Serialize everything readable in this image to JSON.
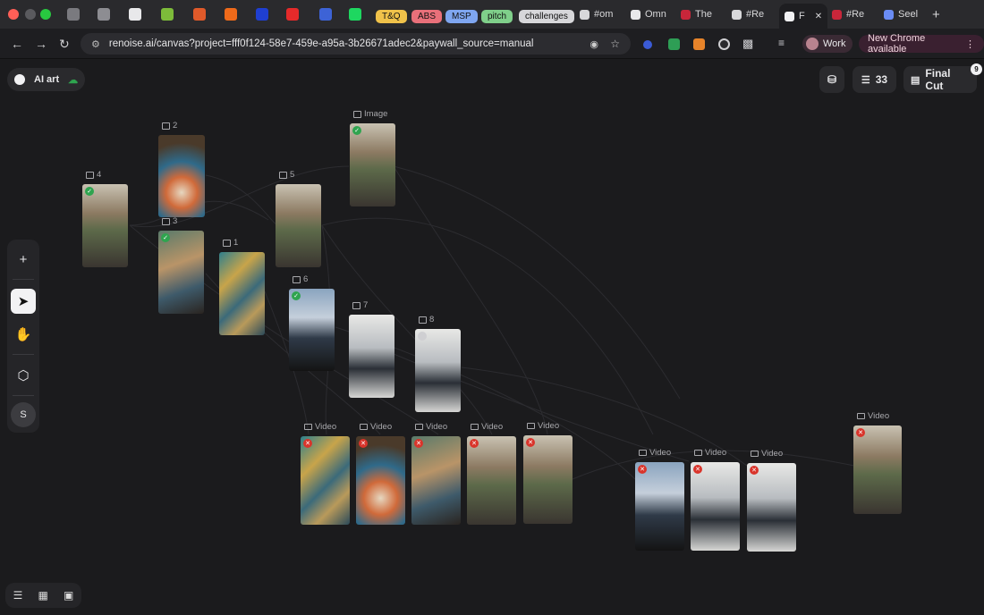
{
  "browser": {
    "tabs": [
      {
        "label": "",
        "color": "#7a7a7f"
      },
      {
        "label": "",
        "color": "#8d8d92"
      },
      {
        "label": "",
        "color": "#e8e8ea"
      },
      {
        "label": "",
        "color": "#7dbb3a"
      },
      {
        "label": "",
        "color": "#e05a2a"
      },
      {
        "label": "",
        "color": "#ef6a1a"
      },
      {
        "label": "",
        "color": "#1f3fd1"
      },
      {
        "label": "",
        "color": "#e52a2a"
      },
      {
        "label": "",
        "color": "#3d63d6"
      },
      {
        "label": "",
        "color": "#1ed760"
      }
    ],
    "pills": [
      {
        "label": "T&Q",
        "color": "#f0c24a"
      },
      {
        "label": "ABS",
        "color": "#e9707a"
      },
      {
        "label": "MSP",
        "color": "#7fa6f0"
      },
      {
        "label": "pitch",
        "color": "#7fcf8a"
      },
      {
        "label": "challenges",
        "color": "#d7d7da"
      }
    ],
    "named_tabs": [
      {
        "label": "#om",
        "color": "#d8d8da"
      },
      {
        "label": "Omn",
        "color": "#e8e8ea"
      },
      {
        "label": "The",
        "color": "#c8263a"
      },
      {
        "label": "#Re",
        "color": "#d8d8da"
      },
      {
        "label": "F",
        "color": "#f2f2f4",
        "active": true
      },
      {
        "label": "#Re",
        "color": "#c8263a"
      },
      {
        "label": "Seel",
        "color": "#6a8cf5"
      }
    ],
    "new_tab": "+",
    "url": "renoise.ai/canvas?project=fff0f124-58e7-459e-a95a-3b26671adec2&paywall_source=manual",
    "profile_label": "Work",
    "update_label": "New Chrome available"
  },
  "app": {
    "project_name": "AI art",
    "task_count": "33",
    "final_cut_label": "Final Cut",
    "final_cut_badge": "9",
    "avatar_initial": "S",
    "tools": [
      "add-icon",
      "select-cursor-icon",
      "hand-pan-icon",
      "cube-icon"
    ],
    "bottom_tools": [
      "layers-icon",
      "grid-icon",
      "fit-screen-icon"
    ]
  },
  "nodes": [
    {
      "id": "4",
      "label": "4",
      "kind": "image",
      "status": "ok",
      "scene": "painter"
    },
    {
      "id": "2",
      "label": "2",
      "kind": "image",
      "status": "none",
      "scene": "palette"
    },
    {
      "id": "3",
      "label": "3",
      "kind": "image",
      "status": "ok",
      "scene": "painter-close"
    },
    {
      "id": "1",
      "label": "1",
      "kind": "image",
      "status": "none",
      "scene": "abstract"
    },
    {
      "id": "5",
      "label": "5",
      "kind": "image",
      "status": "none",
      "scene": "painter"
    },
    {
      "id": "img",
      "label": "Image",
      "kind": "image",
      "status": "ok",
      "scene": "painter"
    },
    {
      "id": "6",
      "label": "6",
      "kind": "image",
      "status": "ok",
      "scene": "office"
    },
    {
      "id": "7",
      "label": "7",
      "kind": "image",
      "status": "none",
      "scene": "keyboard"
    },
    {
      "id": "8",
      "label": "8",
      "kind": "image",
      "status": "pend",
      "scene": "keyboard"
    },
    {
      "id": "v1",
      "label": "Video",
      "kind": "video",
      "status": "err",
      "scene": "abstract"
    },
    {
      "id": "v2",
      "label": "Video",
      "kind": "video",
      "status": "err",
      "scene": "palette"
    },
    {
      "id": "v3",
      "label": "Video",
      "kind": "video",
      "status": "err",
      "scene": "painter-close"
    },
    {
      "id": "v4",
      "label": "Video",
      "kind": "video",
      "status": "err",
      "scene": "painter"
    },
    {
      "id": "v5",
      "label": "Video",
      "kind": "video",
      "status": "err",
      "scene": "painter"
    },
    {
      "id": "v6",
      "label": "Video",
      "kind": "video",
      "status": "err",
      "scene": "office"
    },
    {
      "id": "v7",
      "label": "Video",
      "kind": "video",
      "status": "err",
      "scene": "keyboard"
    },
    {
      "id": "v8",
      "label": "Video",
      "kind": "video",
      "status": "err",
      "scene": "keyboard"
    },
    {
      "id": "v9",
      "label": "Video",
      "kind": "video",
      "status": "err",
      "scene": "painter"
    }
  ]
}
